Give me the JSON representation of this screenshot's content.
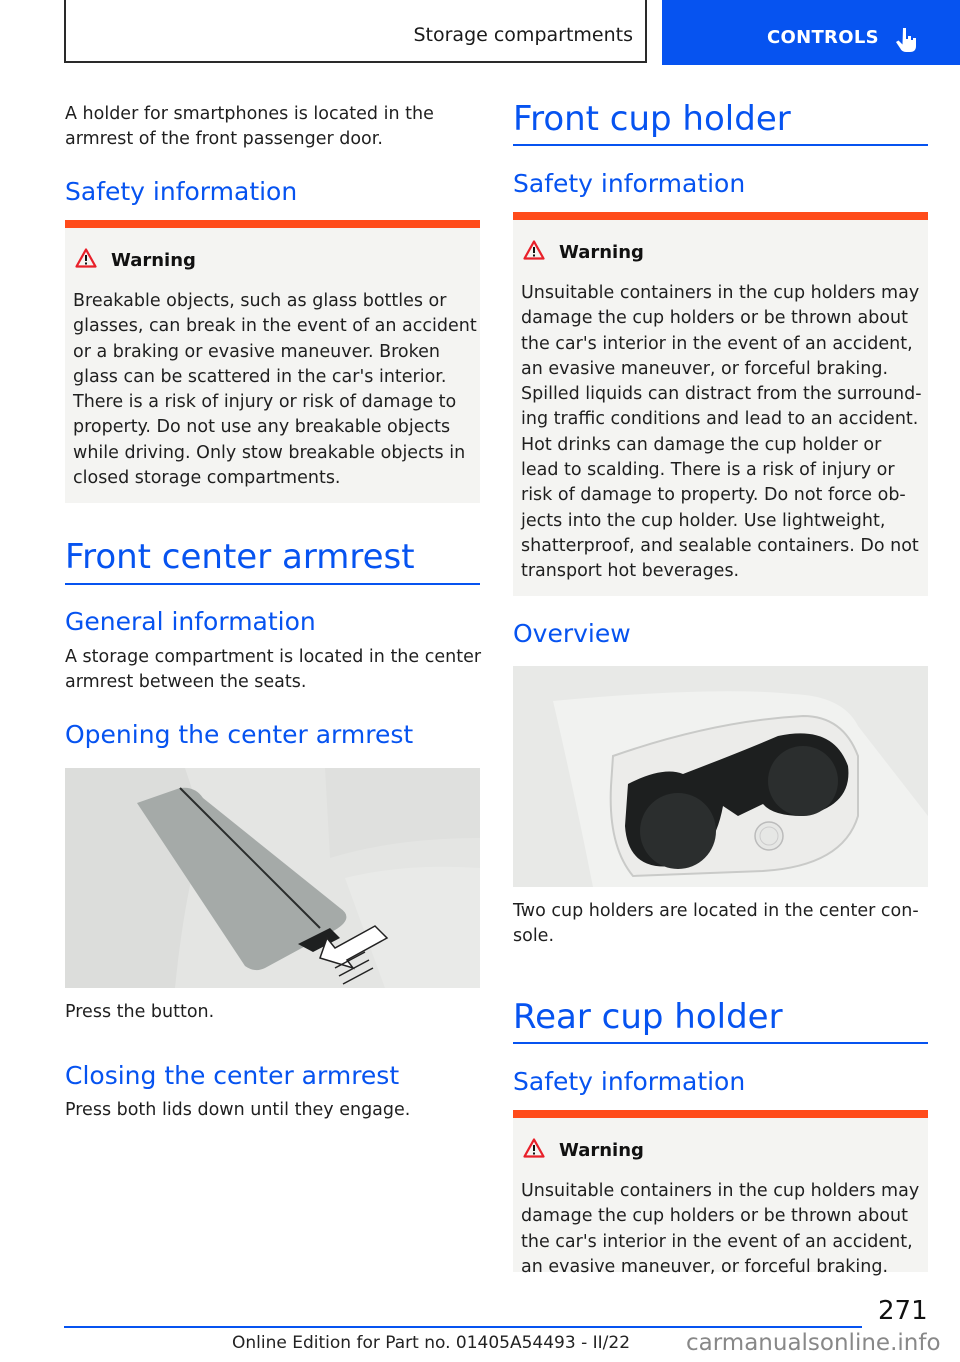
{
  "header": {
    "section": "Storage compartments",
    "chapter": "CONTROLS",
    "chapter_icon": "hand-pointer-icon",
    "accent_color": "#0653f0"
  },
  "left": {
    "intro": "A holder for smartphones is located in the armrest of the front passenger door.",
    "safety_heading": "Safety information",
    "warning": {
      "title": "Warning",
      "icon": "warning-triangle-icon",
      "lines": [
        "Breakable objects, such as glass bottles or",
        "glasses, can break in the event of an accident",
        "or a braking or evasive maneuver. Broken",
        "glass can be scattered in the car's interior.",
        "There is a risk of injury or risk of damage to",
        "property. Do not use any breakable objects",
        "while driving. Only stow breakable objects in",
        "closed storage compartments."
      ]
    },
    "armrest_heading": "Front center armrest",
    "general_heading": "General information",
    "general_text": [
      "A storage compartment is located in the center",
      "armrest between the seats."
    ],
    "opening_heading": "Opening the center armrest",
    "opening_caption": "Press the button.",
    "closing_heading": "Closing the center armrest",
    "closing_text": "Press both lids down until they engage."
  },
  "right": {
    "front_heading": "Front cup holder",
    "safety_heading": "Safety information",
    "warning": {
      "title": "Warning",
      "icon": "warning-triangle-icon",
      "lines": [
        "Unsuitable containers in the cup holders may",
        "damage the cup holders or be thrown about",
        "the car's interior in the event of an accident,",
        "an evasive maneuver, or forceful braking.",
        "Spilled liquids can distract from the surround-",
        "ing traffic conditions and lead to an accident.",
        "Hot drinks can damage the cup holder or",
        "lead to scalding. There is a risk of injury or",
        "risk of damage to property. Do not force ob-",
        "jects into the cup holder. Use lightweight,",
        "shatterproof, and sealable containers. Do not",
        "transport hot beverages."
      ]
    },
    "overview_heading": "Overview",
    "overview_caption": [
      "Two cup holders are located in the center con-",
      "sole."
    ],
    "rear_heading": "Rear cup holder",
    "rear_safety_heading": "Safety information",
    "rear_warning": {
      "title": "Warning",
      "icon": "warning-triangle-icon",
      "lines": [
        "Unsuitable containers in the cup holders may",
        "damage the cup holders or be thrown about",
        "the car's interior in the event of an accident,",
        "an evasive maneuver, or forceful braking."
      ]
    }
  },
  "footer": {
    "page_number": "271",
    "edition": "Online Edition for Part no. 01405A54493 - II/22",
    "watermark": "carmanualsonline.info"
  }
}
